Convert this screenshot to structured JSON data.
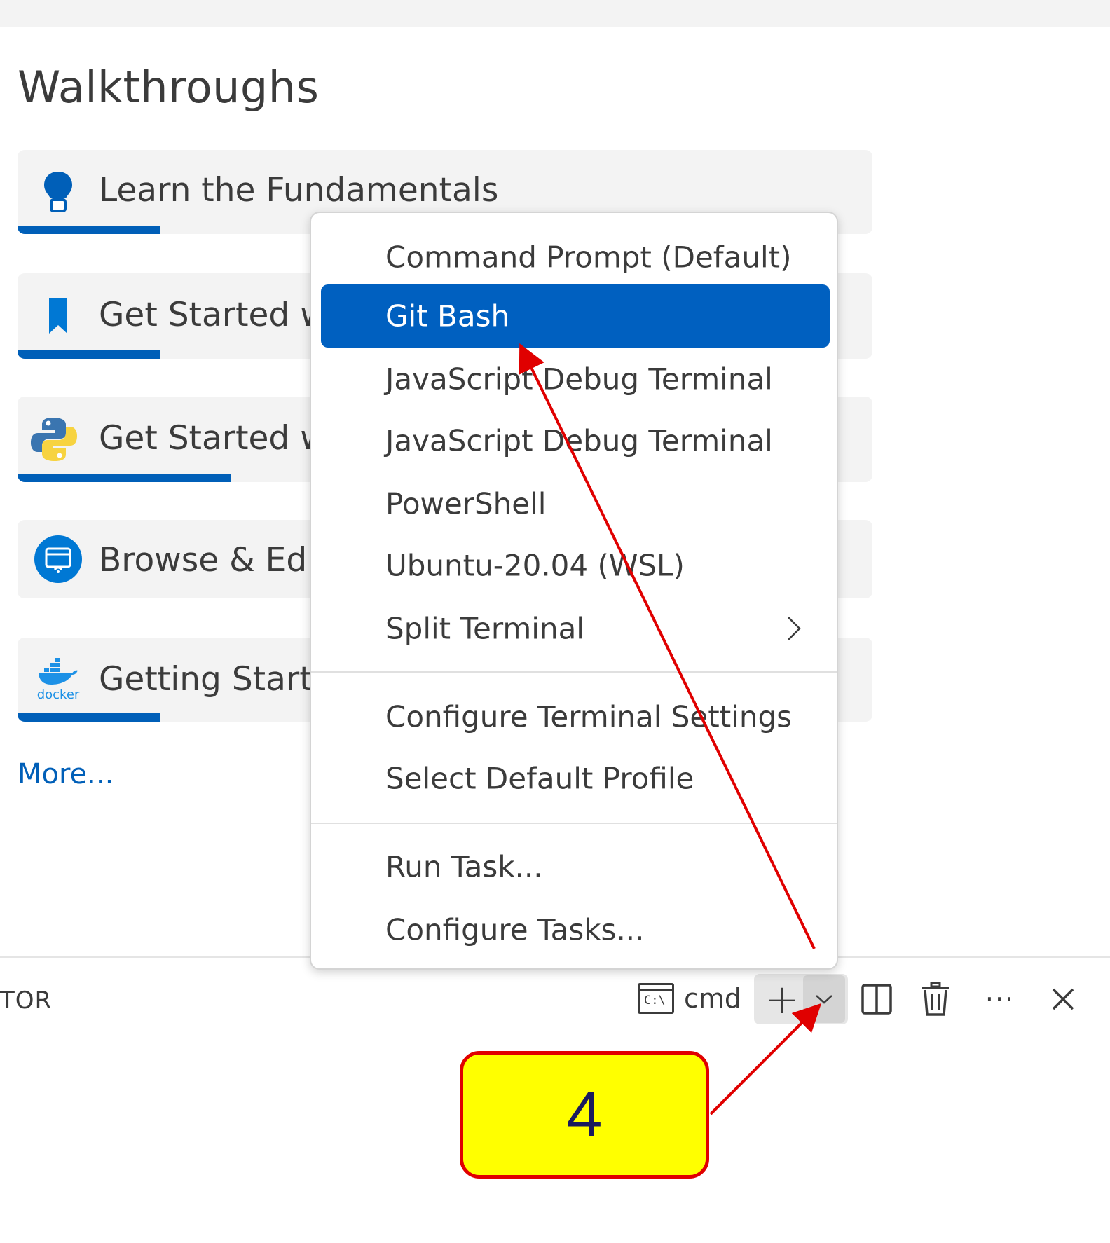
{
  "walkthroughs": {
    "heading": "Walkthroughs",
    "cards": [
      {
        "title": "Learn the Fundamentals",
        "icon": "lightbulb-icon",
        "progress": 0.165
      },
      {
        "title": "Get Started w",
        "icon": "bookmark-icon",
        "progress": 0.165
      },
      {
        "title": "Get Started w",
        "icon": "python-icon",
        "progress": 0.245
      },
      {
        "title": "Browse & Edit",
        "icon": "remote-explorer-icon",
        "progress": 0
      },
      {
        "title": "Getting Starte",
        "icon": "docker-icon",
        "docker_text": "docker",
        "progress": 0.165
      }
    ],
    "more_label": "More..."
  },
  "panel": {
    "label": "TOR",
    "terminal": {
      "icon_text": "C:\\",
      "name": "cmd"
    },
    "buttons": {
      "new_terminal": "+",
      "more": "···"
    }
  },
  "dropdown": {
    "items": [
      {
        "label": "Command Prompt (Default)",
        "selected": false
      },
      {
        "label": "Git Bash",
        "selected": true
      },
      {
        "label": "JavaScript Debug Terminal",
        "selected": false
      },
      {
        "label": "JavaScript Debug Terminal",
        "selected": false
      },
      {
        "label": "PowerShell",
        "selected": false
      },
      {
        "label": "Ubuntu-20.04 (WSL)",
        "selected": false
      },
      {
        "label": "Split Terminal",
        "selected": false,
        "has_submenu": true
      }
    ],
    "group2": [
      {
        "label": "Configure Terminal Settings"
      },
      {
        "label": "Select Default Profile"
      }
    ],
    "group3": [
      {
        "label": "Run Task..."
      },
      {
        "label": "Configure Tasks..."
      }
    ]
  },
  "annotation": {
    "step_number": "4",
    "color": "#e00000",
    "fill": "#ffff00"
  },
  "colors": {
    "accent": "#005fb8",
    "selected": "#0060c0",
    "link": "#005fb8"
  }
}
